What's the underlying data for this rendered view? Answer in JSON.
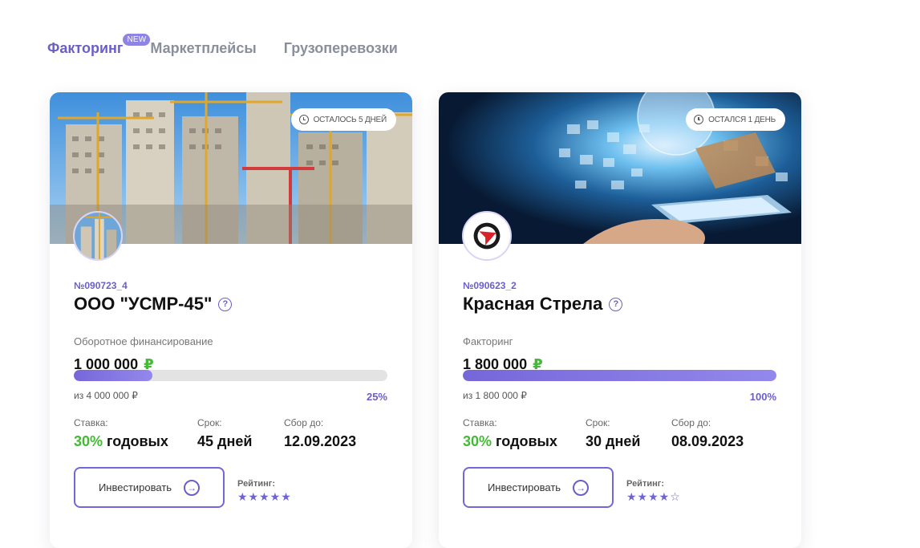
{
  "tabs": [
    {
      "label": "Факторинг",
      "active": true,
      "badge": "NEW"
    },
    {
      "label": "Маркетплейсы",
      "active": false
    },
    {
      "label": "Грузоперевозки",
      "active": false
    }
  ],
  "cards": [
    {
      "timer": "ОСТАЛОСЬ 5 ДНЕЙ",
      "lot": "№090723_4",
      "title": "ООО \"УСМР-45\"",
      "help": "?",
      "subtitle": "Оборотное финансирование",
      "amount": "1 000 000",
      "currency": "₽",
      "progress_percent": 25,
      "of_text": "из 4 000 000 ₽",
      "pct_text": "25%",
      "rate_label": "Ставка:",
      "rate_value": "30%",
      "rate_suffix": "годовых",
      "term_label": "Срок:",
      "term_value": "45 дней",
      "collect_label": "Сбор до:",
      "collect_value": "12.09.2023",
      "invest_label": "Инвестировать",
      "rating_label": "Рейтинг:",
      "rating_stars": "★★★★★",
      "rating_value": 5
    },
    {
      "timer": "ОСТАЛСЯ 1 ДЕНЬ",
      "lot": "№090623_2",
      "title": "Красная Стрела",
      "help": "?",
      "subtitle": "Факторинг",
      "amount": "1 800 000",
      "currency": "₽",
      "progress_percent": 100,
      "of_text": "из 1 800 000 ₽",
      "pct_text": "100%",
      "rate_label": "Ставка:",
      "rate_value": "30%",
      "rate_suffix": "годовых",
      "term_label": "Срок:",
      "term_value": "30 дней",
      "collect_label": "Сбор до:",
      "collect_value": "08.09.2023",
      "invest_label": "Инвестировать",
      "rating_label": "Рейтинг:",
      "rating_stars": "★★★★☆",
      "rating_value": 4
    }
  ],
  "colors": {
    "accent": "#6a5fc9",
    "green": "#44b936",
    "muted": "#8a8f9c"
  }
}
